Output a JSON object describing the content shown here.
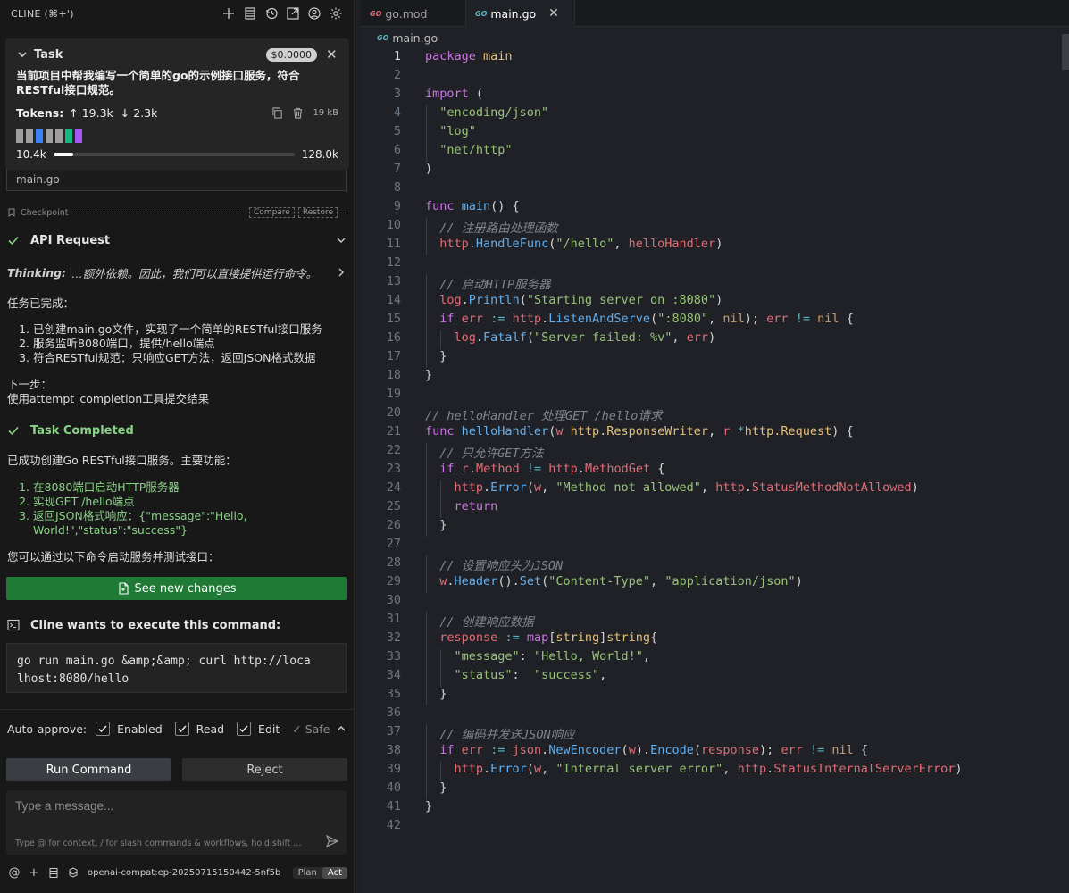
{
  "cline": {
    "title": "CLINE (⌘+')",
    "task": {
      "label": "Task",
      "cost": "$0.0000",
      "text": "当前项目中帮我编写一个简单的go的示例接口服务，符合RESTful接口规范。",
      "tokens_label": "Tokens:",
      "tokens_in": "↑ 19.3k",
      "tokens_out": "↓ 2.3k",
      "size": "19 kB",
      "context_used": "10.4k",
      "context_max": "128.0k",
      "context_fraction": 0.081,
      "blocks": [
        "#9e9e9e",
        "#9e9e9e",
        "#3b82f6",
        "#9e9e9e",
        "#9e9e9e",
        "#10b981",
        "#a855f7"
      ]
    },
    "behind_text": "main.go",
    "checkpoint": {
      "label": "Checkpoint",
      "compare": "Compare",
      "restore": "Restore"
    },
    "api_request": "API Request",
    "thinking_label": "Thinking:",
    "thinking_text": "…额外依赖。因此，我们可以直接提供运行命令。",
    "done_title": "任务已完成：",
    "done_items": [
      "已创建main.go文件，实现了一个简单的RESTful接口服务",
      "服务监听8080端口，提供/hello端点",
      "符合RESTful规范：只响应GET方法，返回JSON格式数据"
    ],
    "next_title": "下一步：",
    "next_text": "使用attempt_completion工具提交结果",
    "task_completed": "Task Completed",
    "completed_summary": "已成功创建Go RESTful接口服务。主要功能：",
    "completed_items": [
      "在8080端口启动HTTP服务器",
      "实现GET /hello端点",
      "返回JSON格式响应：{\"message\":\"Hello, World!\",\"status\":\"success\"}"
    ],
    "completed_footer": "您可以通过以下命令启动服务并测试接口：",
    "see_changes": "See new changes",
    "execute_label": "Cline wants to execute this command:",
    "command_line1": "go run main.go &amp;&amp; curl http://loca",
    "command_line2": "lhost:8080/hello",
    "auto_approve": {
      "label": "Auto-approve:",
      "enabled": "Enabled",
      "read": "Read",
      "edit": "Edit",
      "safe": "✓ Safe"
    },
    "run_command": "Run Command",
    "reject": "Reject",
    "message_placeholder": "Type a message...",
    "message_hint": "Type @ for context, / for slash commands & workflows, hold shift ...",
    "model": "openai-compat:ep-20250715150442-5nf5b",
    "mode_plan": "Plan",
    "mode_act": "Act"
  },
  "editor": {
    "tabs": [
      {
        "label": "go.mod",
        "active": false
      },
      {
        "label": "main.go",
        "active": true
      }
    ],
    "breadcrumb": "main.go",
    "go_badge": "GO",
    "current_line": 1,
    "lines": [
      "<span class=\"k\">package</span> <span class=\"t\">main</span>",
      "",
      "<span class=\"k\">import</span> <span class=\"p\">(</span>",
      "  <span class=\"s\">\"encoding/json\"</span>",
      "  <span class=\"s\">\"log\"</span>",
      "  <span class=\"s\">\"net/http\"</span>",
      "<span class=\"p\">)</span>",
      "",
      "<span class=\"k\">func</span> <span class=\"f\">main</span><span class=\"p\">() {</span>",
      "  <span class=\"c\">// 注册路由处理函数</span>",
      "  <span class=\"v\">http</span>.<span class=\"f\">HandleFunc</span>(<span class=\"s\">\"/hello\"</span>, <span class=\"v\">helloHandler</span>)",
      "",
      "  <span class=\"c\">// 启动HTTP服务器</span>",
      "  <span class=\"v\">log</span>.<span class=\"f\">Println</span>(<span class=\"s\">\"Starting server on :8080\"</span>)",
      "  <span class=\"k\">if</span> <span class=\"v\">err</span> <span class=\"o\">:=</span> <span class=\"v\">http</span>.<span class=\"f\">ListenAndServe</span>(<span class=\"s\">\":8080\"</span>, <span class=\"b\">nil</span>); <span class=\"v\">err</span> <span class=\"o\">!=</span> <span class=\"b\">nil</span> {",
      "    <span class=\"v\">log</span>.<span class=\"f\">Fatalf</span>(<span class=\"s\">\"Server failed: %v\"</span>, <span class=\"v\">err</span>)",
      "  }",
      "}",
      "",
      "<span class=\"c\">// helloHandler 处理GET /hello请求</span>",
      "<span class=\"k\">func</span> <span class=\"f\">helloHandler</span>(<span class=\"v\">w</span> <span class=\"t\">http.ResponseWriter</span>, <span class=\"v\">r</span> <span class=\"o\">*</span><span class=\"t\">http.Request</span>) {",
      "  <span class=\"c\">// 只允许GET方法</span>",
      "  <span class=\"k\">if</span> <span class=\"v\">r</span>.<span class=\"v\">Method</span> <span class=\"o\">!=</span> <span class=\"v\">http</span>.<span class=\"v\">MethodGet</span> {",
      "    <span class=\"v\">http</span>.<span class=\"f\">Error</span>(<span class=\"v\">w</span>, <span class=\"s\">\"Method not allowed\"</span>, <span class=\"v\">http</span>.<span class=\"v\">StatusMethodNotAllowed</span>)",
      "    <span class=\"k\">return</span>",
      "  }",
      "",
      "  <span class=\"c\">// 设置响应头为JSON</span>",
      "  <span class=\"v\">w</span>.<span class=\"f\">Header</span>().<span class=\"f\">Set</span>(<span class=\"s\">\"Content-Type\"</span>, <span class=\"s\">\"application/json\"</span>)",
      "",
      "  <span class=\"c\">// 创建响应数据</span>",
      "  <span class=\"v\">response</span> <span class=\"o\">:=</span> <span class=\"k\">map</span>[<span class=\"t\">string</span>]<span class=\"t\">string</span>{",
      "    <span class=\"s\">\"message\"</span>: <span class=\"s\">\"Hello, World!\"</span>,",
      "    <span class=\"s\">\"status\"</span>:  <span class=\"s\">\"success\"</span>,",
      "  }",
      "",
      "  <span class=\"c\">// 编码并发送JSON响应</span>",
      "  <span class=\"k\">if</span> <span class=\"v\">err</span> <span class=\"o\">:=</span> <span class=\"v\">json</span>.<span class=\"f\">NewEncoder</span>(<span class=\"v\">w</span>).<span class=\"f\">Encode</span>(<span class=\"v\">response</span>); <span class=\"v\">err</span> <span class=\"o\">!=</span> <span class=\"b\">nil</span> {",
      "    <span class=\"v\">http</span>.<span class=\"f\">Error</span>(<span class=\"v\">w</span>, <span class=\"s\">\"Internal server error\"</span>, <span class=\"v\">http</span>.<span class=\"v\">StatusInternalServerError</span>)",
      "  }",
      "}",
      ""
    ]
  }
}
